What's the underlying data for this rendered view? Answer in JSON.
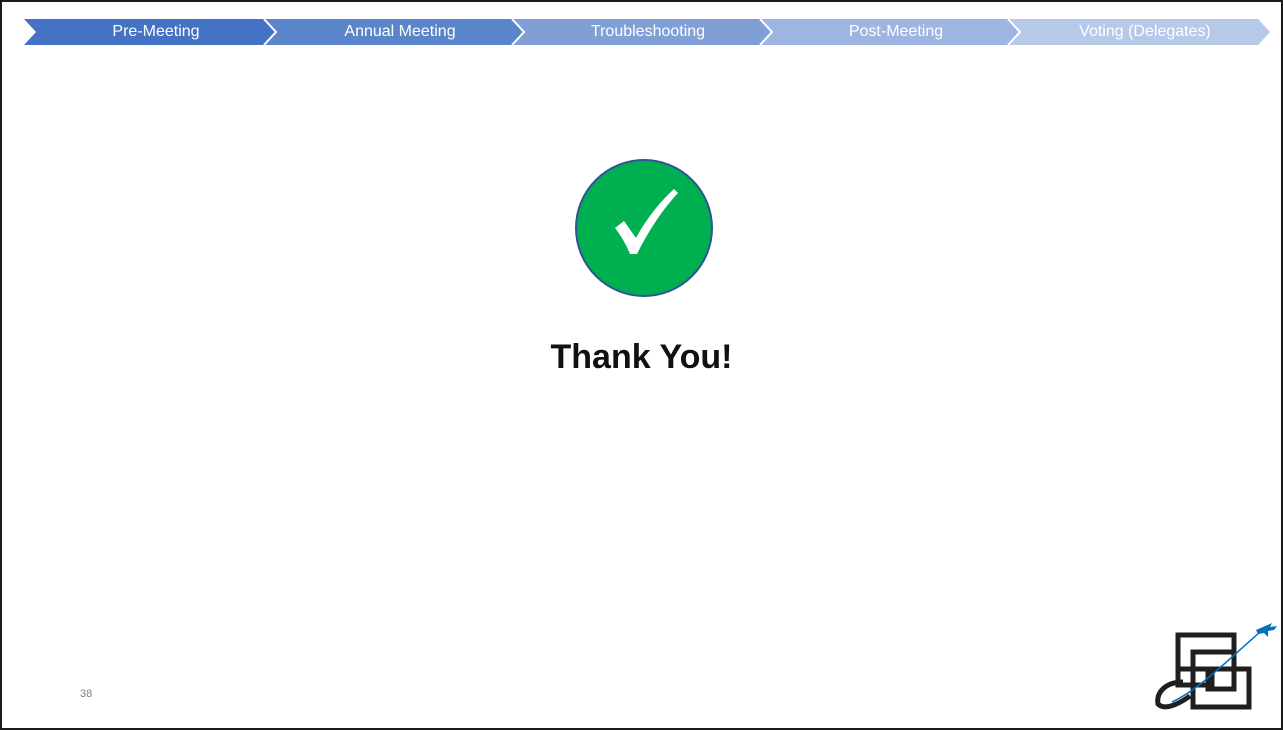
{
  "process_steps": [
    {
      "label": "Pre-Meeting",
      "color": "#4472c4"
    },
    {
      "label": "Annual Meeting",
      "color": "#5b85ca"
    },
    {
      "label": "Troubleshooting",
      "color": "#7f9fd6"
    },
    {
      "label": "Post-Meeting",
      "color": "#9db5e0"
    },
    {
      "label": "Voting (Delegates)",
      "color": "#b7c9e9"
    }
  ],
  "badge": {
    "icon": "checkmark-icon",
    "fill_color": "#00b050",
    "border_color": "#2f5597"
  },
  "heading": "Thank You!",
  "page_number": "38",
  "logo": {
    "icon": "brick-logo-with-airplane-icon",
    "color": "#1f1f1f",
    "accent": "#0070c0"
  }
}
